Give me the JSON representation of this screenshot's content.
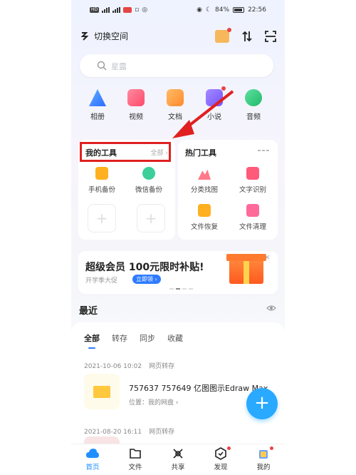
{
  "status_bar": {
    "left_chip": "HD",
    "battery": "84%",
    "time": "22:56"
  },
  "topbar": {
    "space_switch": "切换空间"
  },
  "search": {
    "placeholder": "星露"
  },
  "categories": [
    {
      "label": "相册",
      "color": "#3b8cff",
      "dot": true
    },
    {
      "label": "视频",
      "color": "#ff5a7a",
      "dot": false
    },
    {
      "label": "文档",
      "color": "#ff9a3d",
      "dot": false
    },
    {
      "label": "小说",
      "color": "#8f6bff",
      "dot": false
    },
    {
      "label": "音频",
      "color": "#2fcf7a",
      "dot": false
    }
  ],
  "my_tools": {
    "title": "我的工具",
    "all": "全部",
    "items": [
      {
        "label": "手机备份",
        "color": "#ffb020"
      },
      {
        "label": "微信备份",
        "color": "#3ccf9a"
      }
    ]
  },
  "hot_tools": {
    "title": "热门工具",
    "items": [
      {
        "label": "分类找图",
        "color": "#ff7a8a"
      },
      {
        "label": "文字识别",
        "color": "#ff5a7a"
      },
      {
        "label": "文件恢复",
        "color": "#ffb020"
      },
      {
        "label": "文件清理",
        "color": "#ff6a9a"
      }
    ]
  },
  "banner": {
    "title": "超级会员 100元限时补贴!",
    "subtitle": "开学季大促",
    "button": "立即领",
    "close": "×"
  },
  "recent": {
    "title": "最近",
    "tabs": [
      "全部",
      "转存",
      "同步",
      "收藏"
    ],
    "entries": [
      {
        "date": "2021-10-06 10:02",
        "action": "网页转存",
        "name": "757637 757649 亿图图示Edraw Max",
        "location": "位置：我的网盘"
      },
      {
        "date": "2021-08-20 16:11",
        "action": "网页转存"
      }
    ]
  },
  "fab": {
    "label": "+"
  },
  "tabbar": [
    {
      "label": "首页",
      "active": true
    },
    {
      "label": "文件",
      "active": false
    },
    {
      "label": "共享",
      "active": false
    },
    {
      "label": "发现",
      "active": false,
      "dot": true
    },
    {
      "label": "我的",
      "active": false,
      "dot": true
    }
  ],
  "colors": {
    "accent": "#2f7bff",
    "fab": "#29a9ff",
    "annotation": "#e02020"
  }
}
